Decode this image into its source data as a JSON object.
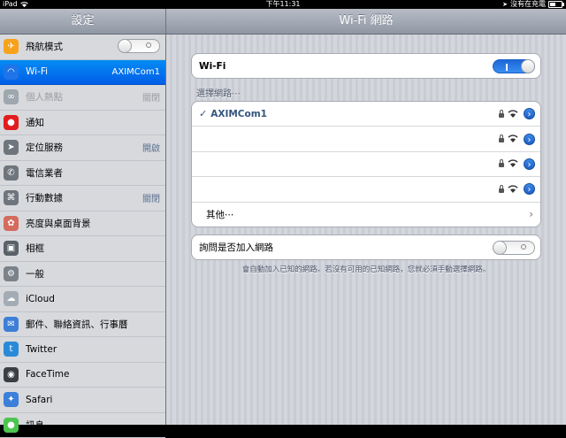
{
  "status_bar": {
    "device": "iPad",
    "time": "下午11:31",
    "charging_text": "沒有在充電",
    "battery_level": 0.5
  },
  "sidebar": {
    "title": "設定",
    "items": [
      {
        "label": "飛航模式",
        "icon": "airplane-icon",
        "toggle": "off",
        "color": "#f7a21b"
      },
      {
        "label": "Wi-Fi",
        "value": "AXIMCom1",
        "icon": "wifi-icon",
        "selected": true,
        "color": "#1e74e8"
      },
      {
        "label": "個人熱點",
        "value": "關閉",
        "icon": "hotspot-icon",
        "disabled": true,
        "color": "#9ea6ae"
      },
      {
        "label": "通知",
        "icon": "notifications-icon",
        "color": "#e21d1d"
      },
      {
        "label": "定位服務",
        "value": "開啟",
        "icon": "location-icon",
        "color": "#6e757d"
      },
      {
        "label": "電信業者",
        "icon": "carrier-icon",
        "color": "#6e757d"
      },
      {
        "label": "行動數據",
        "value": "關閉",
        "icon": "cellular-icon",
        "color": "#6e757d"
      },
      {
        "label": "亮度與桌面背景",
        "icon": "brightness-icon",
        "color": "#d46b5d"
      },
      {
        "label": "相框",
        "icon": "picture-frame-icon",
        "color": "#5a6168"
      },
      {
        "label": "一般",
        "icon": "gear-icon",
        "color": "#7b8289"
      },
      {
        "label": "iCloud",
        "icon": "cloud-icon",
        "color": "#a3acb4"
      },
      {
        "label": "郵件、聯絡資訊、行事曆",
        "icon": "mail-icon",
        "color": "#3d7fd6"
      },
      {
        "label": "Twitter",
        "icon": "twitter-icon",
        "color": "#2b8ad8"
      },
      {
        "label": "FaceTime",
        "icon": "facetime-icon",
        "color": "#3b3f44"
      },
      {
        "label": "Safari",
        "icon": "safari-icon",
        "color": "#3b7fd8"
      },
      {
        "label": "訊息",
        "icon": "messages-icon",
        "color": "#4cc54f"
      }
    ]
  },
  "main": {
    "title": "Wi-Fi 網路",
    "wifi_label": "Wi-Fi",
    "wifi_toggle": "on",
    "choose_network_header": "選擇網路⋯",
    "networks": [
      {
        "name": "AXIMCom1",
        "connected": true
      },
      {
        "name": ""
      },
      {
        "name": ""
      },
      {
        "name": ""
      }
    ],
    "other_label": "其他⋯",
    "ask_join_label": "詢問是否加入網路",
    "ask_join_toggle": "off",
    "footnote": "會自動加入已知的網路。若沒有可用的已知網路，您就必須手動選擇網路。"
  }
}
